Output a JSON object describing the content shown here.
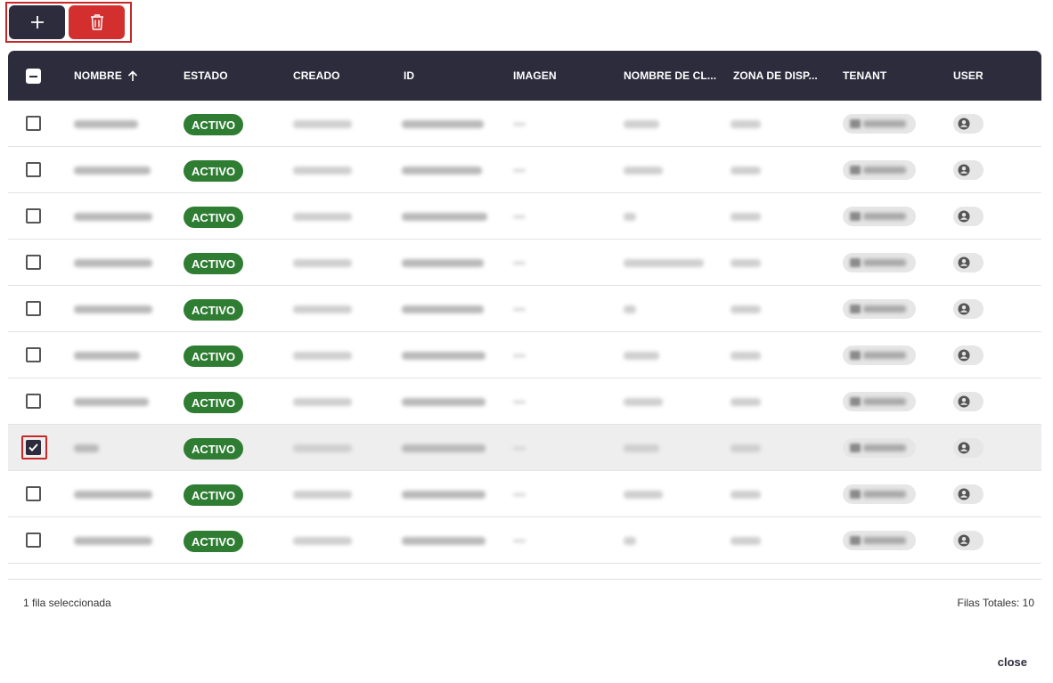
{
  "toolbar": {
    "add_icon": "plus-icon",
    "delete_icon": "trash-icon"
  },
  "table": {
    "columns": [
      {
        "label": "NOMBRE",
        "sort_icon": "arrow-up-icon"
      },
      {
        "label": "ESTADO"
      },
      {
        "label": "CREADO"
      },
      {
        "label": "ID"
      },
      {
        "label": "IMAGEN"
      },
      {
        "label": "NOMBRE DE CL..."
      },
      {
        "label": "ZONA DE DISP..."
      },
      {
        "label": "TENANT"
      },
      {
        "label": "USER"
      }
    ],
    "rows": [
      {
        "estado": "ACTIVO",
        "selected": false
      },
      {
        "estado": "ACTIVO",
        "selected": false
      },
      {
        "estado": "ACTIVO",
        "selected": false
      },
      {
        "estado": "ACTIVO",
        "selected": false
      },
      {
        "estado": "ACTIVO",
        "selected": false
      },
      {
        "estado": "ACTIVO",
        "selected": false
      },
      {
        "estado": "ACTIVO",
        "selected": false
      },
      {
        "estado": "ACTIVO",
        "selected": true
      },
      {
        "estado": "ACTIVO",
        "selected": false
      },
      {
        "estado": "ACTIVO",
        "selected": false
      }
    ]
  },
  "footer": {
    "selection_text": "1 fila seleccionada",
    "total_text": "Filas Totales: 10"
  },
  "dialog": {
    "close_label": "close"
  },
  "colors": {
    "header_bg": "#2d2c3c",
    "delete_bg": "#d32f2f",
    "status_bg": "#2e7d32",
    "highlight_border": "#c62828"
  }
}
